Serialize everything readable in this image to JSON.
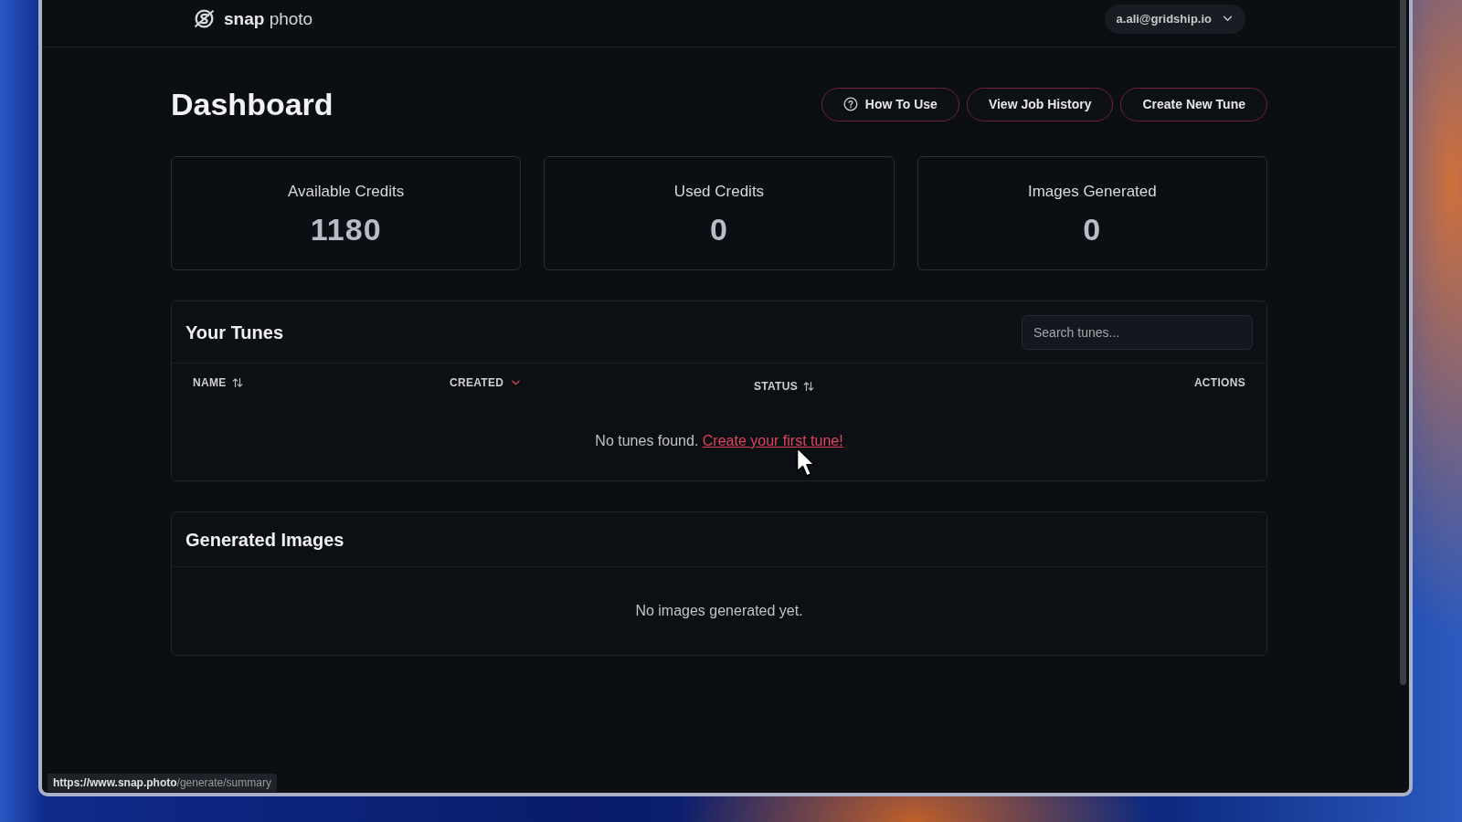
{
  "nav": {
    "logo": "**snap** photo",
    "account": "a.ali@gridship.io"
  },
  "page": {
    "title": "Dashboard",
    "actions": [
      {
        "label": "How To Use",
        "kind": "help"
      },
      {
        "label": "View Job History",
        "kind": "plain"
      },
      {
        "label": "Create New Tune",
        "kind": "plain"
      }
    ]
  },
  "stats": [
    {
      "label": "Available Credits",
      "value": "1180"
    },
    {
      "label": "Used Credits",
      "value": "0"
    },
    {
      "label": "Images Generated",
      "value": "0"
    }
  ],
  "tunes": {
    "title": "Your Tunes",
    "search": {
      "placeholder": "Search tunes..."
    },
    "columns": [
      {
        "label": "NAME",
        "sortable": true,
        "sorted": false
      },
      {
        "label": "CREATED",
        "sortable": true,
        "sorted": true
      },
      {
        "label": "STATUS",
        "sortable": true,
        "sorted": false
      },
      {
        "label": "ACTIONS",
        "sortable": false,
        "sorted": false
      }
    ],
    "empty": {
      "text": "No tunes found.",
      "link": "Create your first tune!"
    }
  },
  "images": {
    "title": "Generated Images",
    "empty": "No images generated yet."
  },
  "browser": {
    "status_url": "**https://www.snap.photo**/generate/summary"
  }
}
